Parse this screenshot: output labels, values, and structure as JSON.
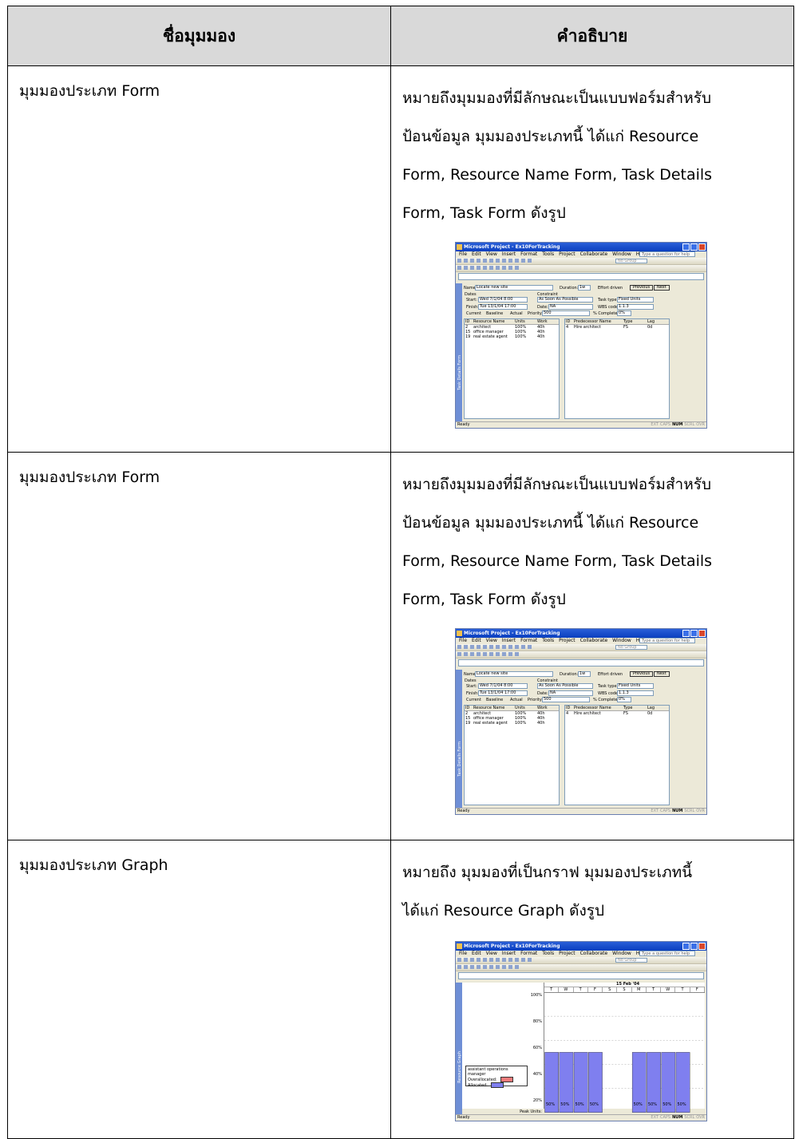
{
  "header": {
    "col_name": "ชื่อมุมมอง",
    "col_desc": "คำอธิบาย"
  },
  "rows": [
    {
      "name": "มุมมองประเภท Form",
      "desc_lines": [
        "หมายถึงมุมมองที่มีลักษณะเป็นแบบฟอร์มสำหรับ",
        "ป้อนข้อมูล  มุมมองประเภทนี้  ได้แก่  Resource",
        "Form, Resource Name Form, Task Details",
        "Form, Task Form ดังรูป"
      ]
    },
    {
      "name": "มุมมองประเภท Form",
      "desc_lines": [
        "หมายถึงมุมมองที่มีลักษณะเป็นแบบฟอร์มสำหรับ",
        "ป้อนข้อมูล  มุมมองประเภทนี้  ได้แก่  Resource",
        "Form, Resource Name Form, Task Details",
        "Form, Task Form ดังรูป"
      ]
    },
    {
      "name": "มุมมองประเภท Graph",
      "desc_lines": [
        "หมายถึง มุมมองที่เป็นกราฟ  มุมมองประเภทนี้",
        "ได้แก่ Resource Graph ดังรูป"
      ]
    }
  ],
  "screenshot": {
    "title": "Microsoft Project - Ex10ForTracking",
    "menu": [
      "File",
      "Edit",
      "View",
      "Insert",
      "Format",
      "Tools",
      "Project",
      "Collaborate",
      "Window",
      "Help"
    ],
    "help_box": "Type a question for help",
    "group_box": "No Group",
    "status": "Ready",
    "status_keys": [
      "EXT",
      "CAPS",
      "NUM",
      "SCRL",
      "OVR"
    ],
    "task_form": {
      "side_label": "Task Details Form",
      "name_label": "Name:",
      "name_value": "Locate new site",
      "duration_label": "Duration:",
      "duration_value": "1w",
      "effort_label": "Effort driven",
      "previous": "Previous",
      "next": "Next",
      "dates_label": "Dates",
      "start_label": "Start:",
      "start_value": "Wed 7/1/04 8:00",
      "finish_label": "Finish:",
      "finish_value": "Tue 13/1/04 17:00",
      "current": "Current",
      "baseline": "Baseline",
      "actual": "Actual",
      "constraint_label": "Constraint",
      "constraint_value": "As Soon As Possible",
      "date_label": "Date:",
      "date_value": "NA",
      "priority_label": "Priority:",
      "priority_value": "500",
      "tasktype_label": "Task type:",
      "tasktype_value": "Fixed Units",
      "wbs_label": "WBS code:",
      "wbs_value": "1.1.3",
      "complete_label": "% Complete:",
      "complete_value": "0%",
      "res_headers": [
        "ID",
        "Resource Name",
        "Units",
        "Work"
      ],
      "res_rows": [
        [
          "2",
          "architect",
          "100%",
          "40h"
        ],
        [
          "15",
          "office manager",
          "100%",
          "40h"
        ],
        [
          "19",
          "real estate agent",
          "100%",
          "40h"
        ]
      ],
      "pred_headers": [
        "ID",
        "Predecessor Name",
        "Type",
        "Lag"
      ],
      "pred_rows": [
        [
          "4",
          "Hire architect",
          "FS",
          "0d"
        ]
      ]
    },
    "graph": {
      "side_label": "Resource Graph",
      "timescale_top": "15 Feb '04",
      "days": [
        "T",
        "W",
        "T",
        "F",
        "S",
        "S",
        "M",
        "T",
        "W",
        "T",
        "F"
      ],
      "legend_title": "assistant operations manager",
      "legend_over": "Overallocated:",
      "legend_alloc": "Allocated:",
      "over_color": "#f07a7a",
      "alloc_color": "#7f7fef",
      "y_ticks": [
        "100%",
        "80%",
        "60%",
        "40%",
        "20%"
      ],
      "peak_label": "Peak Units:",
      "peak_values": [
        "50%",
        "50%",
        "50%",
        "50%",
        "",
        "",
        "50%",
        "50%",
        "50%",
        "50%"
      ]
    }
  }
}
